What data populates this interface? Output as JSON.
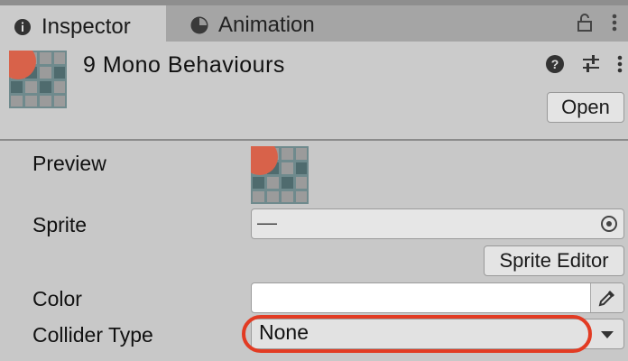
{
  "tabs": [
    {
      "label": "Inspector",
      "icon": "info-icon",
      "active": true
    },
    {
      "label": "Animation",
      "icon": "clock-icon",
      "active": false
    }
  ],
  "tab_actions": {
    "lock_icon": "lock-icon",
    "menu_icon": "kebab-menu-icon"
  },
  "header": {
    "title": "9 Mono Behaviours",
    "open_label": "Open",
    "icons": [
      "help-icon",
      "settings-sliders-icon",
      "kebab-menu-icon"
    ]
  },
  "properties": {
    "preview_label": "Preview",
    "sprite_label": "Sprite",
    "sprite_value": "—",
    "sprite_editor_label": "Sprite Editor",
    "color_label": "Color",
    "color_value": "#ffffff",
    "collider_label": "Collider Type",
    "collider_value": "None"
  },
  "colors": {
    "accent_highlight": "#e23b23",
    "panel_bg": "#cbcbcb",
    "tabbar_bg": "#a5a5a5"
  }
}
